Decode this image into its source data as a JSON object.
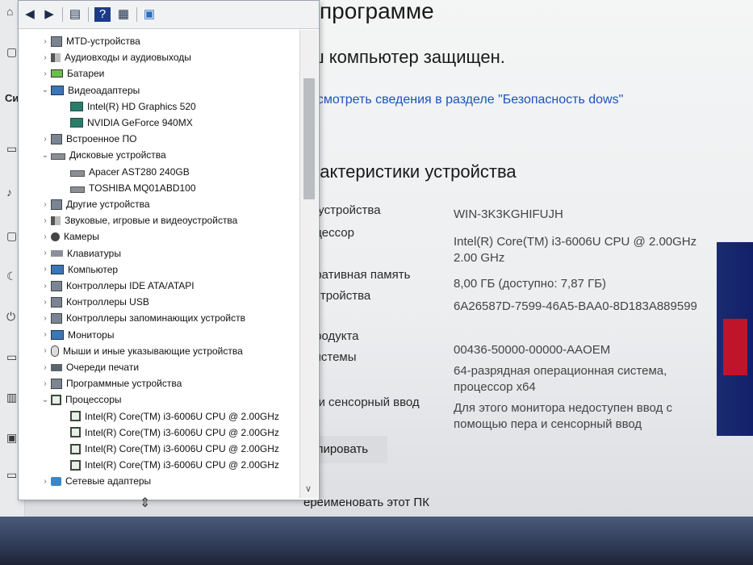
{
  "about_page": {
    "title": "программе",
    "protected": "ш компьютер защищен.",
    "security_link": "осмотреть сведения в разделе \"Безопасность dows\"",
    "specs_heading": "рактеристики устройства",
    "specs": [
      {
        "label": "я устройства",
        "value": "WIN-3K3KGHIFUJH"
      },
      {
        "label": "оцессор",
        "value": "Intel(R) Core(TM) i3-6006U CPU @ 2.00GHz   2.00 GHz"
      },
      {
        "label": "еративная память",
        "value": "8,00 ГБ (доступно: 7,87 ГБ)"
      },
      {
        "label": "устройства",
        "value": "6A26587D-7599-46A5-BAA0-8D183A889599"
      },
      {
        "label": "продукта",
        "value": "00436-50000-00000-AAOEM"
      },
      {
        "label": "системы",
        "value": "64-разрядная операционная система, процессор x64"
      },
      {
        "label": "о и сенсорный ввод",
        "value": "Для этого монитора недоступен ввод с помощью пера и сенсорный ввод"
      }
    ],
    "copy_button": "опировать",
    "rename_link": "ереименовать этот ПК"
  },
  "nav": {
    "partial_label": "Си"
  },
  "device_manager": {
    "toolbar": {
      "back": "back-arrow-icon",
      "forward": "forward-arrow-icon",
      "properties": "properties-icon",
      "help": "help-icon",
      "view": "view-icon",
      "monitor": "monitor-icon"
    },
    "tree": [
      {
        "label": "MTD-устройства",
        "level": 0,
        "expanded": false,
        "icon": "generic"
      },
      {
        "label": "Аудиовходы и аудиовыходы",
        "level": 0,
        "expanded": false,
        "icon": "audio"
      },
      {
        "label": "Батареи",
        "level": 0,
        "expanded": false,
        "icon": "battery"
      },
      {
        "label": "Видеоадаптеры",
        "level": 0,
        "expanded": true,
        "icon": "monitor"
      },
      {
        "label": "Intel(R) HD Graphics 520",
        "level": 1,
        "icon": "gpu"
      },
      {
        "label": "NVIDIA GeForce 940MX",
        "level": 1,
        "icon": "gpu"
      },
      {
        "label": "Встроенное ПО",
        "level": 0,
        "expanded": false,
        "icon": "generic"
      },
      {
        "label": "Дисковые устройства",
        "level": 0,
        "expanded": true,
        "icon": "disk"
      },
      {
        "label": "Apacer AST280 240GB",
        "level": 1,
        "icon": "disk"
      },
      {
        "label": "TOSHIBA MQ01ABD100",
        "level": 1,
        "icon": "disk"
      },
      {
        "label": "Другие устройства",
        "level": 0,
        "expanded": false,
        "icon": "generic"
      },
      {
        "label": "Звуковые, игровые и видеоустройства",
        "level": 0,
        "expanded": false,
        "icon": "audio"
      },
      {
        "label": "Камеры",
        "level": 0,
        "expanded": false,
        "icon": "camera"
      },
      {
        "label": "Клавиатуры",
        "level": 0,
        "expanded": false,
        "icon": "keyboard"
      },
      {
        "label": "Компьютер",
        "level": 0,
        "expanded": false,
        "icon": "monitor"
      },
      {
        "label": "Контроллеры IDE ATA/ATAPI",
        "level": 0,
        "expanded": false,
        "icon": "generic"
      },
      {
        "label": "Контроллеры USB",
        "level": 0,
        "expanded": false,
        "icon": "generic"
      },
      {
        "label": "Контроллеры запоминающих устройств",
        "level": 0,
        "expanded": false,
        "icon": "generic"
      },
      {
        "label": "Мониторы",
        "level": 0,
        "expanded": false,
        "icon": "monitor"
      },
      {
        "label": "Мыши и иные указывающие устройства",
        "level": 0,
        "expanded": false,
        "icon": "mouse"
      },
      {
        "label": "Очереди печати",
        "level": 0,
        "expanded": false,
        "icon": "printer"
      },
      {
        "label": "Программные устройства",
        "level": 0,
        "expanded": false,
        "icon": "generic"
      },
      {
        "label": "Процессоры",
        "level": 0,
        "expanded": true,
        "icon": "chip"
      },
      {
        "label": "Intel(R) Core(TM) i3-6006U CPU @ 2.00GHz",
        "level": 1,
        "icon": "chip"
      },
      {
        "label": "Intel(R) Core(TM) i3-6006U CPU @ 2.00GHz",
        "level": 1,
        "icon": "chip"
      },
      {
        "label": "Intel(R) Core(TM) i3-6006U CPU @ 2.00GHz",
        "level": 1,
        "icon": "chip"
      },
      {
        "label": "Intel(R) Core(TM) i3-6006U CPU @ 2.00GHz",
        "level": 1,
        "icon": "chip"
      },
      {
        "label": "Сетевые адаптеры",
        "level": 0,
        "expanded": false,
        "icon": "network"
      }
    ]
  },
  "colors": {
    "link": "#1a55b8",
    "window_bg": "#ffffff",
    "taskbar": "#2f3b57"
  }
}
